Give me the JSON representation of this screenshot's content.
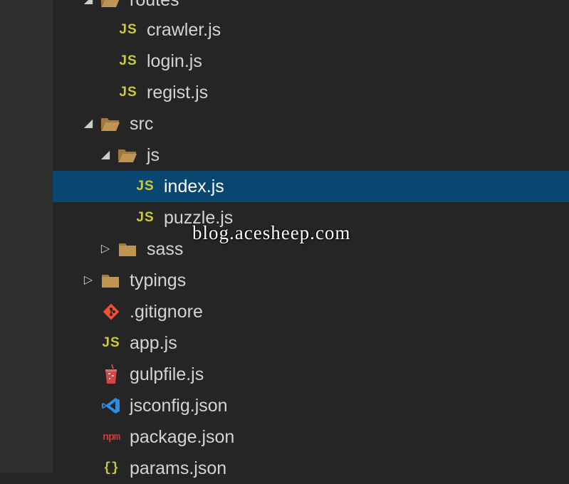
{
  "explorer": {
    "items": [
      {
        "label": "routes",
        "icon": "folder-open-icon",
        "twisty": "expanded"
      },
      {
        "label": "crawler.js",
        "icon": "js-file-icon"
      },
      {
        "label": "login.js",
        "icon": "js-file-icon"
      },
      {
        "label": "regist.js",
        "icon": "js-file-icon"
      },
      {
        "label": "src",
        "icon": "folder-open-icon",
        "twisty": "expanded"
      },
      {
        "label": "js",
        "icon": "folder-open-icon",
        "twisty": "expanded"
      },
      {
        "label": "index.js",
        "icon": "js-file-icon",
        "selected": true
      },
      {
        "label": "puzzle.js",
        "icon": "js-file-icon"
      },
      {
        "label": "sass",
        "icon": "folder-closed-icon",
        "twisty": "collapsed"
      },
      {
        "label": "typings",
        "icon": "folder-closed-icon",
        "twisty": "collapsed"
      },
      {
        "label": ".gitignore",
        "icon": "git-icon"
      },
      {
        "label": "app.js",
        "icon": "js-file-icon"
      },
      {
        "label": "gulpfile.js",
        "icon": "gulp-icon"
      },
      {
        "label": "jsconfig.json",
        "icon": "vscode-icon"
      },
      {
        "label": "package.json",
        "icon": "npm-icon"
      },
      {
        "label": "params.json",
        "icon": "json-icon"
      }
    ],
    "glyphs": {
      "js": "JS",
      "npm": "npm",
      "json": "{}"
    }
  },
  "watermark": "blog.acesheep.com",
  "colors": {
    "background": "#252526",
    "selection": "#094771",
    "folder": "#c09553",
    "js_icon": "#cbcb41",
    "git": "#f05133",
    "vscode": "#2d8de0",
    "npm": "#cb3837",
    "gulp": "#cf4647"
  }
}
